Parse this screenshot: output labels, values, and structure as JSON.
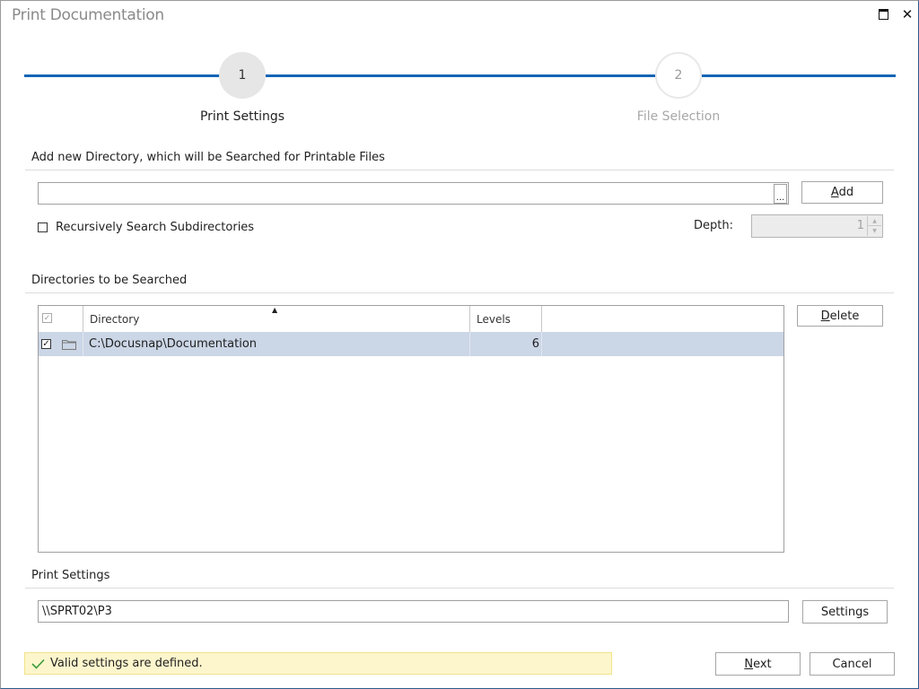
{
  "window": {
    "title": "Print Documentation",
    "maximize_icon": "maximize-icon",
    "close_icon": "close-icon"
  },
  "wizard": {
    "steps": [
      {
        "number": "1",
        "label": "Print Settings",
        "state": "active"
      },
      {
        "number": "2",
        "label": "File Selection",
        "state": "inactive"
      }
    ],
    "accent_color": "#1565b5"
  },
  "add_directory": {
    "section_title": "Add new Directory, which will be Searched for Printable Files",
    "path_value": "",
    "browse_label": "...",
    "add_button": {
      "label": "Add",
      "mnemonic": "A"
    },
    "recursive_checkbox": {
      "label": "Recursively Search Subdirectories",
      "checked": false
    },
    "depth_label": "Depth:",
    "depth_value": "1"
  },
  "directories": {
    "section_title": "Directories to be Searched",
    "columns": [
      "",
      "Directory",
      "Levels",
      ""
    ],
    "rows": [
      {
        "checked": true,
        "icon": "folder-icon",
        "directory": "C:\\Docusnap\\Documentation",
        "levels": "6"
      }
    ],
    "delete_button": {
      "label": "Delete",
      "mnemonic": "D"
    },
    "selected_row_color": "#cbd6e6"
  },
  "print_settings": {
    "section_title": "Print Settings",
    "printer_value": "\\\\SPRT02\\P3",
    "settings_button": "Settings"
  },
  "status": {
    "icon": "checkmark-icon",
    "text": "Valid settings are defined.",
    "color": "#fdf6cc"
  },
  "footer": {
    "next_button": {
      "label": "Next",
      "mnemonic": "N"
    },
    "cancel_button": "Cancel"
  }
}
